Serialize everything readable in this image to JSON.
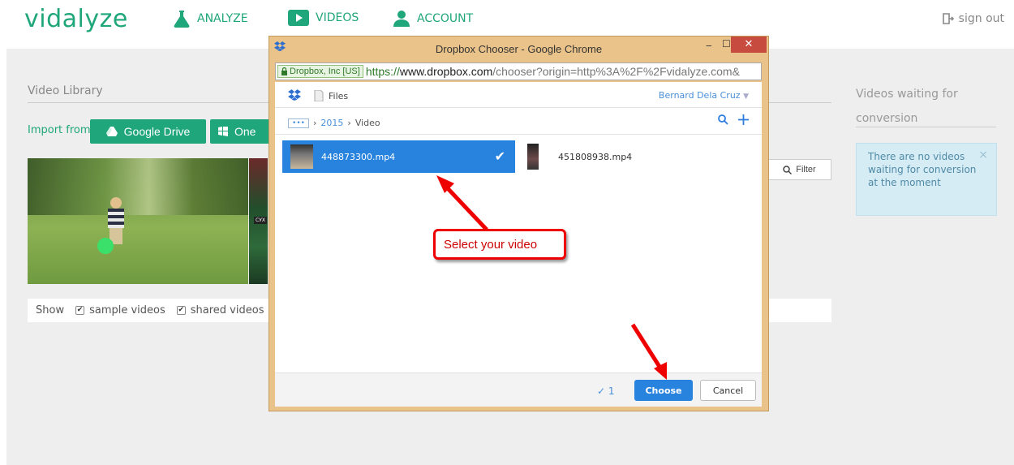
{
  "brand": {
    "logo_text": "vidalyze",
    "accent": "#1fa67a"
  },
  "nav": {
    "analyze": "ANALYZE",
    "videos": "VIDEOS",
    "account": "ACCOUNT",
    "sign_out": "sign out"
  },
  "library": {
    "title": "Video Library",
    "import_from": "Import from",
    "google_drive": "Google Drive",
    "one_partial": "One",
    "filter": "Filter",
    "thumb_tag": "СУХ",
    "show_label": "Show",
    "sample_videos": "sample videos",
    "shared_videos": "shared videos"
  },
  "waiting": {
    "title": "Videos waiting for conversion",
    "message": "There are no videos waiting for conversion at the moment",
    "close": "×"
  },
  "popup": {
    "window_title": "Dropbox Chooser - Google Chrome",
    "ssl_label": "Dropbox, Inc [US]",
    "url_scheme": "https://",
    "url_host": "www.dropbox.com",
    "url_rest": "/chooser?origin=http%3A%2F%2Fvidalyze.com&",
    "files_label": "Files",
    "user_name": "Bernard Dela Cruz",
    "breadcrumb_dots": "•••",
    "breadcrumb_year": "2015",
    "breadcrumb_folder": "Video",
    "files": [
      {
        "name": "448873300.mp4",
        "selected": true
      },
      {
        "name": "451808938.mp4",
        "selected": false
      }
    ],
    "selected_count": "✓ 1",
    "choose": "Choose",
    "cancel": "Cancel"
  },
  "annotation": {
    "callout": "Select your video",
    "color": "#e00000"
  }
}
